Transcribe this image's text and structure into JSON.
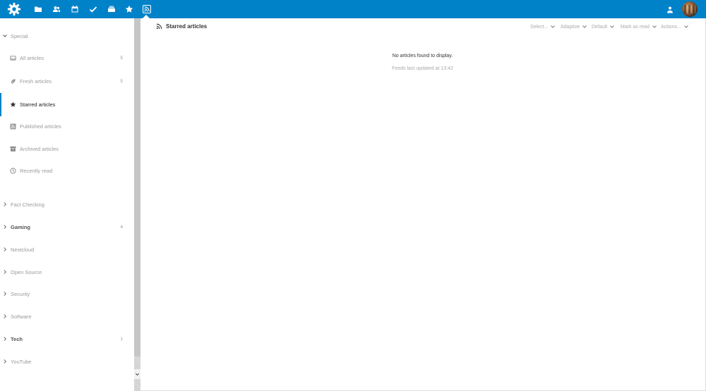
{
  "header": {
    "apps": [
      {
        "name": "files",
        "icon": "folder-icon"
      },
      {
        "name": "contacts",
        "icon": "contacts-icon"
      },
      {
        "name": "calendar",
        "icon": "calendar-icon"
      },
      {
        "name": "tasks",
        "icon": "checkmark-icon"
      },
      {
        "name": "deck",
        "icon": "deck-icon"
      },
      {
        "name": "bookmarks",
        "icon": "star-icon"
      },
      {
        "name": "news",
        "icon": "rss-icon"
      }
    ]
  },
  "sidebar": {
    "special_label": "Special",
    "special_items": [
      {
        "label": "All articles",
        "count": "5",
        "icon": "inbox-icon"
      },
      {
        "label": "Fresh articles",
        "count": "5",
        "icon": "leaf-icon"
      },
      {
        "label": "Starred articles",
        "count": "",
        "icon": "star-icon"
      },
      {
        "label": "Published articles",
        "count": "",
        "icon": "rss-icon"
      },
      {
        "label": "Archived articles",
        "count": "",
        "icon": "archive-icon"
      },
      {
        "label": "Recently read",
        "count": "",
        "icon": "clock-icon"
      }
    ],
    "categories": [
      {
        "label": "Fact Checking",
        "count": ""
      },
      {
        "label": "Gaming",
        "count": "4"
      },
      {
        "label": "Nextcloud",
        "count": ""
      },
      {
        "label": "Open Source",
        "count": ""
      },
      {
        "label": "Security",
        "count": ""
      },
      {
        "label": "Software",
        "count": ""
      },
      {
        "label": "Tech",
        "count": "1"
      },
      {
        "label": "YouTube",
        "count": ""
      }
    ]
  },
  "main": {
    "title": "Starred articles",
    "toolbar": {
      "select": "Select...",
      "view_mode": "Adaptive",
      "order": "Default",
      "mark_as_read": "Mark as read",
      "actions": "Actions..."
    },
    "empty_message": "No articles found to display.",
    "updated_message": "Feeds last updated at 13:42"
  },
  "colors": {
    "header_bg": "#0082c9",
    "active_border": "#0082c9"
  }
}
